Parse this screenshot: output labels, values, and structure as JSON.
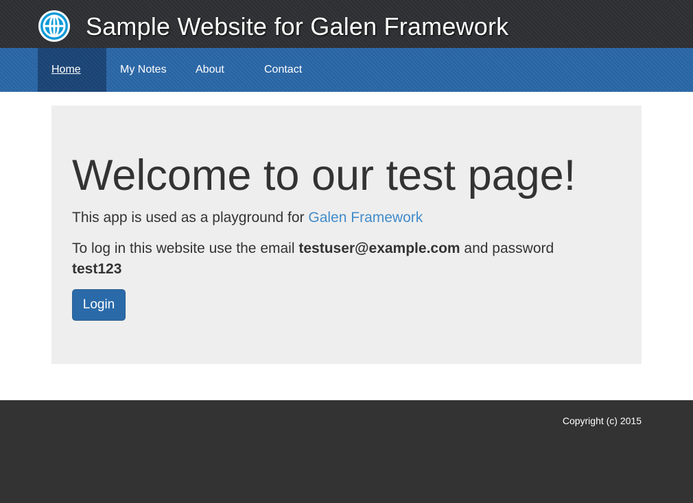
{
  "header": {
    "title": "Sample Website for Galen Framework",
    "logo_icon": "globe-icon"
  },
  "nav": {
    "items": [
      {
        "label": "Home",
        "active": true
      },
      {
        "label": "My Notes",
        "active": false
      },
      {
        "label": "About",
        "active": false
      },
      {
        "label": "Contact",
        "active": false
      }
    ]
  },
  "main": {
    "heading": "Welcome to our test page!",
    "intro_text": "This app is used as a playground for ",
    "intro_link": "Galen Framework",
    "login_text_prefix": "To log in this website use the email ",
    "email": "testuser@example.com",
    "login_text_middle": " and password ",
    "password": "test123",
    "login_button": "Login"
  },
  "footer": {
    "copyright": "Copyright (c) 2015"
  },
  "colors": {
    "header_bg": "#2f3033",
    "nav_bg": "#2a67a7",
    "nav_active_bg": "#1c4677",
    "jumbotron_bg": "#eeeeee",
    "link": "#428bca",
    "button_bg": "#2a6aa9",
    "footer_bg": "#333333"
  }
}
